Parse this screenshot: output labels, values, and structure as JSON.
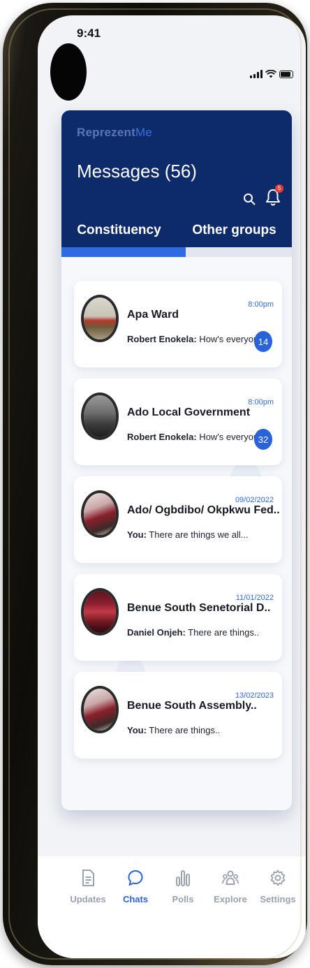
{
  "status_bar": {
    "time": "9:41"
  },
  "header": {
    "brand_part1": "Reprezent",
    "brand_part2": "Me",
    "title": "Messages (56)",
    "notification_count": "5"
  },
  "tabs": [
    {
      "label": "Constituency",
      "active": true
    },
    {
      "label": "Other groups",
      "active": false
    }
  ],
  "chats": [
    {
      "name": "Apa Ward",
      "time": "8:00pm",
      "sender": "Robert Enokela:",
      "message": " How's everyone...",
      "unread": "14",
      "avatar": "classroom-photo"
    },
    {
      "name": "Ado Local Government",
      "time": "8:00pm",
      "sender": "Robert Enokela:",
      "message": " How's everyone...",
      "unread": "32",
      "avatar": "forest-photo"
    },
    {
      "name": "Ado/ Ogbdibo/ Okpkwu Fed..",
      "time": "09/02/2022",
      "sender": "You:",
      "message": " There are things we all...",
      "unread": "",
      "avatar": "wine-photo"
    },
    {
      "name": "Benue South Senetorial D..",
      "time": "11/01/2022",
      "sender": "Daniel Onjeh:",
      "message": " There are things..",
      "unread": "",
      "avatar": "bottles-photo"
    },
    {
      "name": "Benue South Assembly..",
      "time": "13/02/2023",
      "sender": "You:",
      "message": " There are things..",
      "unread": "",
      "avatar": "wine-photo"
    }
  ],
  "bottom_nav": [
    {
      "label": "Updates",
      "icon": "document-icon",
      "active": false
    },
    {
      "label": "Chats",
      "icon": "chat-bubble-icon",
      "active": true
    },
    {
      "label": "Polls",
      "icon": "bar-chart-icon",
      "active": false
    },
    {
      "label": "Explore",
      "icon": "people-icon",
      "active": false
    },
    {
      "label": "Settings",
      "icon": "gear-icon",
      "active": false
    }
  ],
  "colors": {
    "header_bg": "#0d2a6b",
    "accent": "#2a63d8",
    "badge_red": "#e23b3b"
  }
}
